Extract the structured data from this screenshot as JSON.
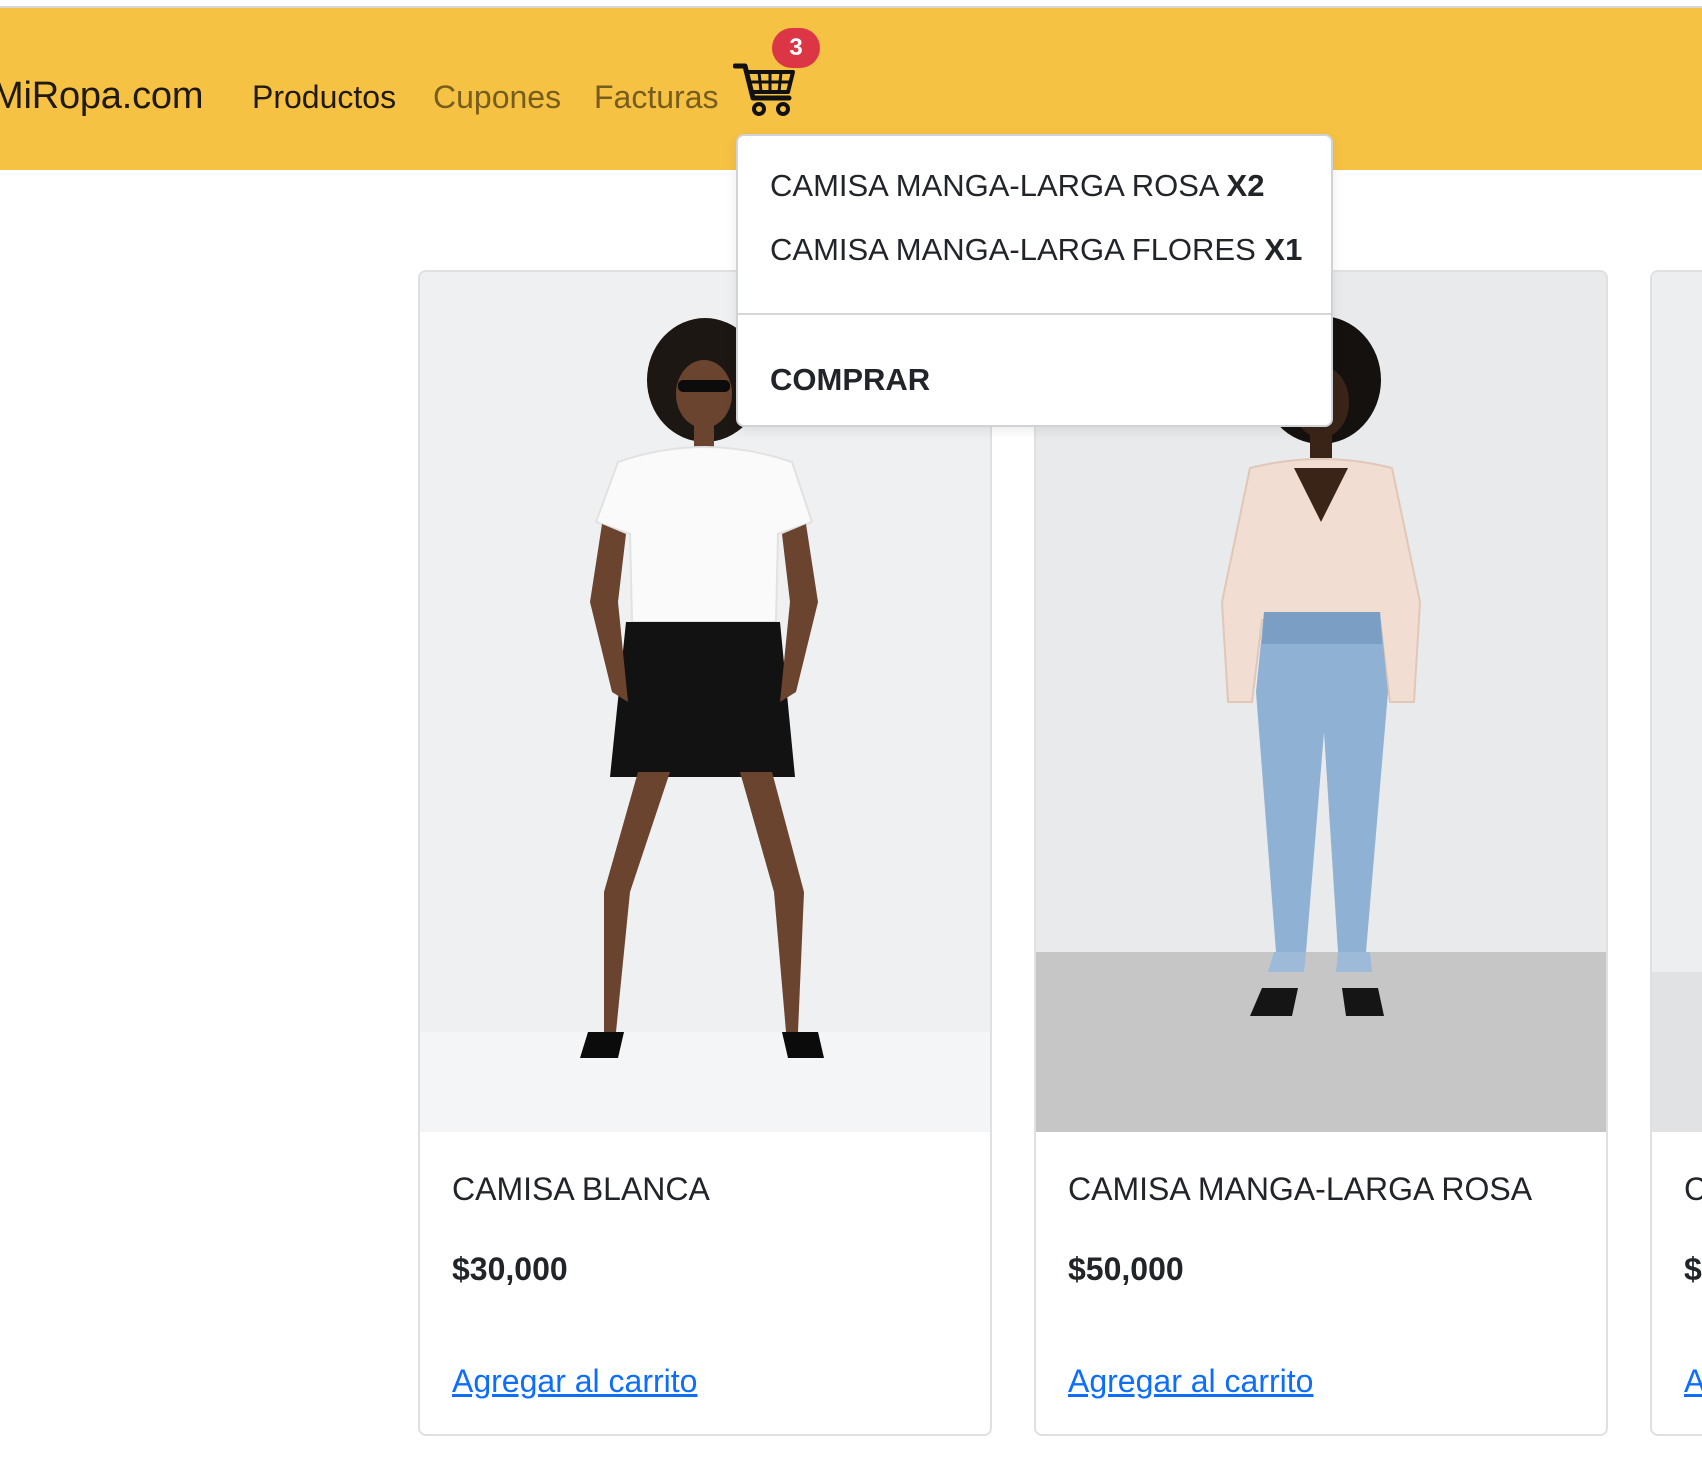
{
  "navbar": {
    "brand": "MiRopa.com",
    "links": [
      {
        "label": "Productos",
        "active": true
      },
      {
        "label": "Cupones",
        "active": false
      },
      {
        "label": "Facturas",
        "active": false
      }
    ],
    "cart_icon": "shopping-cart-icon",
    "cart_count": "3",
    "background_color": "#f6c244",
    "badge_color": "#dc3545"
  },
  "cart_dropdown": {
    "items": [
      {
        "name": "CAMISA MANGA-LARGA ROSA",
        "qty": "X2"
      },
      {
        "name": "CAMISA MANGA-LARGA FLORES",
        "qty": "X1"
      }
    ],
    "buy_label": "COMPRAR"
  },
  "products": [
    {
      "title": "CAMISA BLANCA",
      "price": "$30,000",
      "action": "Agregar al carrito"
    },
    {
      "title": "CAMISA MANGA-LARGA ROSA",
      "price": "$50,000",
      "action": "Agregar al carrito"
    },
    {
      "title": "C",
      "price": "$",
      "action": "A"
    }
  ],
  "link_color": "#0d6efd"
}
